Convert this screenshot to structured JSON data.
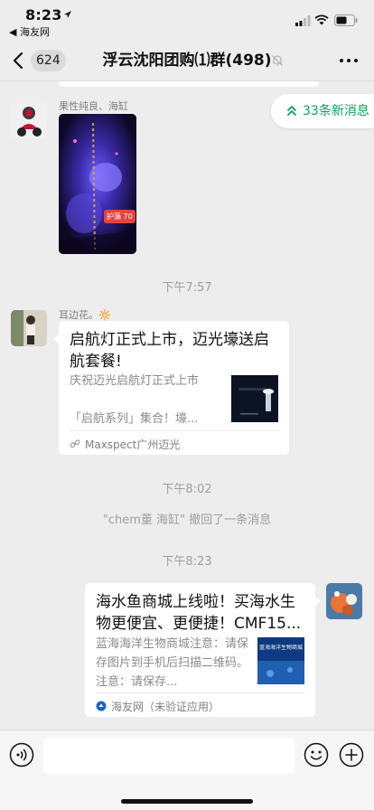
{
  "status_bar": {
    "time": "8:23",
    "back_app": "◀ 海友网"
  },
  "header": {
    "unread_count": "624",
    "title": "浮云沈阳团购⑴群(498)"
  },
  "new_messages_pill": "33条新消息",
  "messages": {
    "m1": {
      "sender": "果性纯良、海缸",
      "video_badge": "护藻 70"
    },
    "t1": "下午7:57",
    "m2": {
      "sender": "耳边花。🔆",
      "card_title": "启航灯正式上市，迈光壕送启航套餐!",
      "card_desc": "庆祝迈光启航灯正式上市\n\n「启航系列」集合！壕...",
      "source": "Maxspect广州迈光"
    },
    "t2": "下午8:02",
    "sys": "\"chem董 海缸\" 撤回了一条消息",
    "t3": "下午8:23",
    "m3": {
      "card_title": "海水鱼商城上线啦！买海水生物更便宜、更便捷！CMF15...",
      "card_desc": "蓝海海洋生物商城注意：请保存图片到手机后扫描二维码。注意：请保存...",
      "thumb_text": "蓝海海洋生物商城",
      "source": "海友网（未验证应用）"
    }
  },
  "colors": {
    "accent_green": "#07a35a",
    "background": "#ededed"
  }
}
